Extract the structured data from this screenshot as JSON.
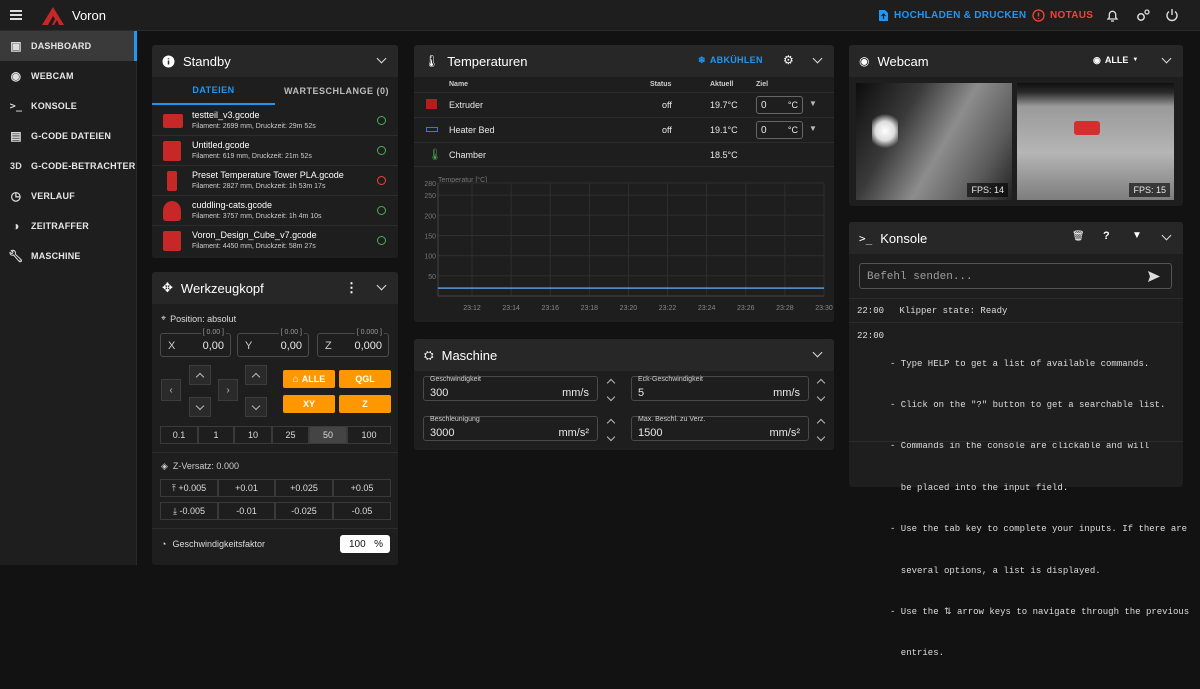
{
  "app": {
    "title": "Voron"
  },
  "topbar": {
    "upload_print": "HOCHLADEN & DRUCKEN",
    "emergency_stop": "NOTAUS",
    "colors": {
      "upload": "#2196f3",
      "emergency": "#f44336"
    }
  },
  "sidebar": {
    "items": [
      {
        "label": "DASHBOARD",
        "icon": "monitor-dashboard-icon",
        "active": true
      },
      {
        "label": "WEBCAM",
        "icon": "webcam-icon"
      },
      {
        "label": "KONSOLE",
        "icon": "console-icon"
      },
      {
        "label": "G-CODE DATEIEN",
        "icon": "file-document-icon"
      },
      {
        "label": "G-CODE-BETRACHTER",
        "icon": "3d-icon"
      },
      {
        "label": "VERLAUF",
        "icon": "history-icon"
      },
      {
        "label": "ZEITRAFFER",
        "icon": "timelapse-icon"
      },
      {
        "label": "MASCHINE",
        "icon": "wrench-icon"
      }
    ]
  },
  "status_panel": {
    "title": "Standby",
    "tabs": [
      "DATEIEN",
      "WARTESCHLANGE (0)"
    ],
    "files": [
      {
        "name": "testteil_v3.gcode",
        "meta": "Filament: 2699 mm, Druckzeit: 29m 52s",
        "status": "ok"
      },
      {
        "name": "Untitled.gcode",
        "meta": "Filament: 619 mm, Druckzeit: 21m 52s",
        "status": "ok"
      },
      {
        "name": "Preset Temperature Tower PLA.gcode",
        "meta": "Filament: 2827 mm, Druckzeit: 1h 53m 17s",
        "status": "failed"
      },
      {
        "name": "cuddling-cats.gcode",
        "meta": "Filament: 3757 mm, Druckzeit: 1h 4m 10s",
        "status": "ok"
      },
      {
        "name": "Voron_Design_Cube_v7.gcode",
        "meta": "Filament: 4450 mm, Druckzeit: 58m 27s",
        "status": "ok"
      }
    ]
  },
  "toolhead": {
    "title": "Werkzeugkopf",
    "position_label": "Position: absolut",
    "axes": [
      {
        "name": "X",
        "limit": "[ 0.00 ]",
        "value": "0,00"
      },
      {
        "name": "Y",
        "limit": "[ 0.00 ]",
        "value": "0,00"
      },
      {
        "name": "Z",
        "limit": "[ 0.000 ]",
        "value": "0,000"
      }
    ],
    "home_all": "ALLE",
    "qgl": "QGL",
    "home_xy": "XY",
    "home_z": "Z",
    "step_sizes": [
      "0.1",
      "1",
      "10",
      "25",
      "50",
      "100"
    ],
    "selected_step": "50",
    "z_offset_label": "Z-Versatz: 0.000",
    "z_up": [
      "+0.005",
      "+0.01",
      "+0.025",
      "+0.05"
    ],
    "z_down": [
      "-0.005",
      "-0.01",
      "-0.025",
      "-0.05"
    ],
    "speed_factor_label": "Geschwindigkeitsfaktor",
    "speed_factor_value": "100",
    "speed_factor_unit": "%"
  },
  "temperatures": {
    "title": "Temperaturen",
    "cooldown": "ABKÜHLEN",
    "headers": {
      "name": "Name",
      "status": "Status",
      "actual": "Aktuell",
      "target": "Ziel"
    },
    "rows": [
      {
        "name": "Extruder",
        "status": "off",
        "actual": "19.7°C",
        "target": "0",
        "unit": "°C",
        "icon": "extruder-icon",
        "color": "#e53935"
      },
      {
        "name": "Heater Bed",
        "status": "off",
        "actual": "19.1°C",
        "target": "0",
        "unit": "°C",
        "icon": "heater-bed-icon",
        "color": "#2979ff"
      },
      {
        "name": "Chamber",
        "status": "",
        "actual": "18.5°C",
        "icon": "thermometer-icon",
        "color": "#4caf50"
      }
    ]
  },
  "chart_data": {
    "type": "line",
    "ylabel": "Temperatur [°C]",
    "ylim": [
      0,
      280
    ],
    "y_ticks": [
      50,
      100,
      150,
      200,
      250,
      280
    ],
    "x": [
      "23:12",
      "23:14",
      "23:16",
      "23:18",
      "23:20",
      "23:22",
      "23:24",
      "23:26",
      "23:28",
      "23:30"
    ],
    "series": [
      {
        "values": [
          19.5,
          19.5,
          19.5,
          19.5,
          19.5,
          19.5,
          19.5,
          19.5,
          19.5,
          19.5
        ],
        "color": "#5b9bd5"
      }
    ],
    "grid": true
  },
  "machine": {
    "title": "Maschine",
    "fields": [
      {
        "label": "Geschwindigkeit",
        "value": "300",
        "unit": "mm/s"
      },
      {
        "label": "Eck-Geschwindigkeit",
        "value": "5",
        "unit": "mm/s"
      },
      {
        "label": "Beschleunigung",
        "value": "3000",
        "unit": "mm/s²"
      },
      {
        "label": "Max. Beschl. zu Verz.",
        "value": "1500",
        "unit": "mm/s²"
      }
    ]
  },
  "webcam": {
    "title": "Webcam",
    "selector": "ALLE",
    "feeds": [
      {
        "fps": "FPS: 14"
      },
      {
        "fps": "FPS: 15"
      }
    ]
  },
  "console": {
    "title": "Konsole",
    "input_placeholder": "Befehl senden...",
    "entries": [
      {
        "time": "22:00",
        "lines": [
          "Klipper state: Ready"
        ]
      },
      {
        "time": "22:00",
        "lines": [
          "- Type HELP to get a list of available commands.",
          "- Click on the \"?\" button to get a searchable list.",
          "- Commands in the console are clickable and will",
          "  be placed into the input field.",
          "- Use the tab key to complete your inputs. If there are",
          "  several options, a list is displayed.",
          "- Use the ⇅ arrow keys to navigate through the previous",
          "  entries."
        ]
      }
    ]
  }
}
